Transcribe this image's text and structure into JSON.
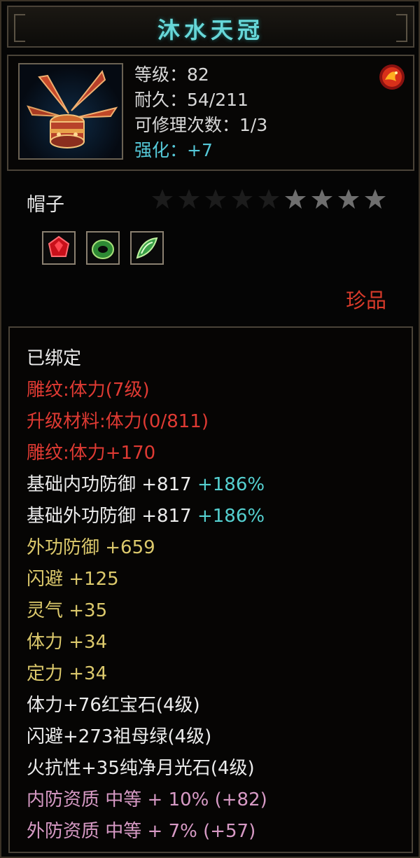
{
  "title": "沐水天冠",
  "info": {
    "level": "等级：82",
    "durability": "耐久：54/211",
    "repairs": "可修理次数：1/3",
    "enhance": "强化：+7"
  },
  "item_type": "帽子",
  "stars": {
    "total": 9,
    "lit": 4
  },
  "gems": [
    "red-ruby-icon",
    "green-emerald-ring-icon",
    "green-moonstone-icon"
  ],
  "rarity": "珍品",
  "attributes": {
    "bound": "已绑定",
    "engrave1": "雕纹:体力(7级)",
    "upgrade_mat": "升级材料:体力(0/811)",
    "engrave2": "雕纹:体力+170",
    "base_inner_def": "基础内功防御 +817",
    "base_inner_pct": "+186%",
    "base_outer_def": "基础外功防御 +817",
    "base_outer_pct": "+186%",
    "outer_def": "外功防御 +659",
    "dodge": "闪避 +125",
    "spirit": "灵气 +35",
    "stamina": "体力 +34",
    "focus": "定力 +34",
    "gem1": "体力+76红宝石(4级)",
    "gem2": "闪避+273祖母绿(4级)",
    "gem3": "火抗性+35纯净月光石(4级)",
    "inner_quality": "内防资质 中等 + 10% (+82)",
    "outer_quality": "外防资质 中等 + 7% (+57)"
  },
  "colors": {
    "title": "#67d7d8",
    "enhance": "#55c8d8",
    "engrave": "#df3a33",
    "bonus": "#dcc96c",
    "quality": "#d79ac5",
    "rarity": "#d83a2a"
  }
}
